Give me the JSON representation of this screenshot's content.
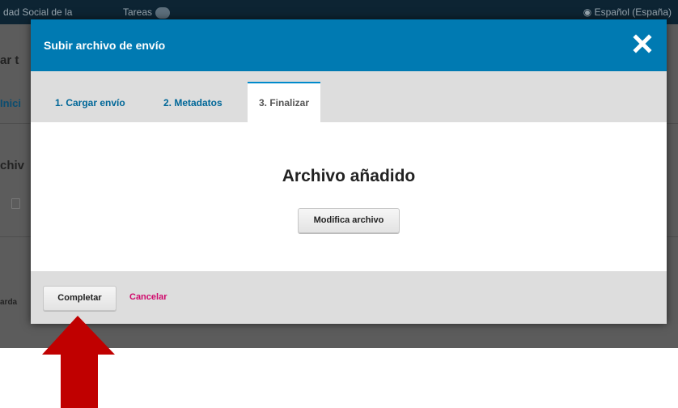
{
  "background": {
    "topbar_left": "dad Social de la",
    "topbar_mid": "Tareas",
    "topbar_right": "Español (España)",
    "fragments": [
      "ar t",
      "Inici",
      "chiv",
      "arda"
    ]
  },
  "modal": {
    "title": "Subir archivo de envío",
    "close_icon": "close-icon",
    "tabs": [
      {
        "label": "1. Cargar envío",
        "active": false
      },
      {
        "label": "2. Metadatos",
        "active": false
      },
      {
        "label": "3. Finalizar",
        "active": true
      }
    ],
    "body": {
      "heading": "Archivo añadido",
      "modify_button": "Modifica archivo"
    },
    "footer": {
      "complete_button": "Completar",
      "cancel_link": "Cancelar"
    }
  },
  "colors": {
    "header": "#007ab2",
    "tab_text": "#006798",
    "cancel": "#d00a6c",
    "arrow": "#c00000"
  },
  "annotation": {
    "icon": "arrow-up-icon"
  }
}
